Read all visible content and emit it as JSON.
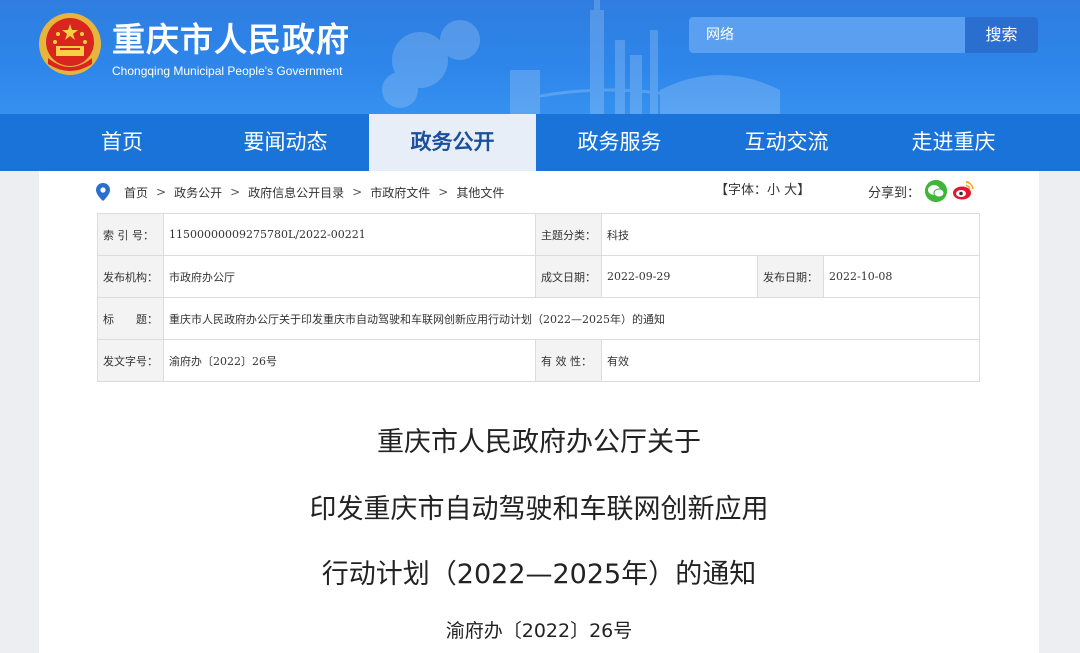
{
  "header": {
    "title": "重庆市人民政府",
    "subtitle": "Chongqing Municipal People's Government",
    "search_value": "网络",
    "search_button": "搜索"
  },
  "nav": [
    "首页",
    "要闻动态",
    "政务公开",
    "政务服务",
    "互动交流",
    "走进重庆"
  ],
  "breadcrumb": [
    "首页",
    "政务公开",
    "政府信息公开目录",
    "市政府文件",
    "其他文件"
  ],
  "breadcrumb_sep": ">",
  "font_control": {
    "prefix": "【字体：",
    "small": "小",
    "large": "大",
    "suffix": "】"
  },
  "share_label": "分享到：",
  "meta": {
    "index_label": "索 引 号：",
    "index_value": "11500000009275780L/2022-00221",
    "category_label": "主题分类：",
    "category_value": "科技",
    "issuer_label": "发布机构：",
    "issuer_value": "市政府办公厅",
    "created_label": "成文日期：",
    "created_value": "2022-09-29",
    "published_label": "发布日期：",
    "published_value": "2022-10-08",
    "title_label": "标　　题：",
    "title_value": "重庆市人民政府办公厅关于印发重庆市自动驾驶和车联网创新应用行动计划（2022—2025年）的通知",
    "docno_label": "发文字号：",
    "docno_value": "渝府办〔2022〕26号",
    "validity_label": "有 效 性：",
    "validity_value": "有效"
  },
  "document": {
    "title_lines": [
      "重庆市人民政府办公厅关于",
      "印发重庆市自动驾驶和车联网创新应用",
      "行动计划（2022—2025年）的通知"
    ],
    "number": "渝府办〔2022〕26号"
  },
  "colors": {
    "header": "#2e86ea",
    "nav": "#1a73d8",
    "nav_active_bg": "#e8eef8",
    "nav_active_text": "#1a4f9c"
  }
}
